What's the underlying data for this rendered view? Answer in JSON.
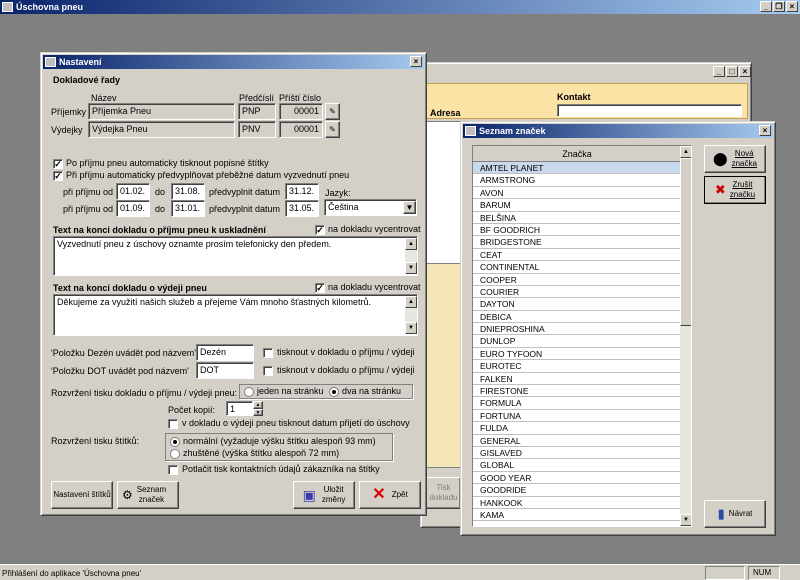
{
  "app": {
    "title": "Úschovna pneu",
    "status_text": "Přihlášení do aplikace 'Úschovna pneu'",
    "status_num": "NUM"
  },
  "background_window": {
    "col_adresa": "Adresa",
    "col_kontakt": "Kontakt"
  },
  "settings": {
    "title": "Nastavení",
    "section_doc_series": "Dokladové řady",
    "col_nazev": "Název",
    "col_predcisli": "Předčíslí",
    "col_pristi_cislo": "Příští číslo",
    "rows": [
      {
        "label": "Příjemky",
        "name": "Příjemka Pneu",
        "prefix": "PNP",
        "next": "00001"
      },
      {
        "label": "Výdejky",
        "name": "Výdejka Pneu",
        "prefix": "PNV",
        "next": "00001"
      }
    ],
    "chk_print_labels": "Po příjmu pneu automaticky tisknout popisné štítky",
    "chk_auto_fill": "Při příjmu automaticky předvyplňovat přeběžné datum vyzvednutí pneu",
    "ranges": [
      {
        "prefix": "při příjmu od",
        "from": "01.02.",
        "to_word": "do",
        "to": "31.08.",
        "fill_word": "předvyplnit datum",
        "date": "31.12."
      },
      {
        "prefix": "při příjmu od",
        "from": "01.09.",
        "to_word": "do",
        "to": "31.01.",
        "fill_word": "předvyplnit datum",
        "date": "31.05."
      }
    ],
    "language_label": "Jazyk:",
    "language_value": "Čeština",
    "receipt_text_label": "Text na konci dokladu o příjmu pneu k uskladnění",
    "receipt_center": "na dokladu vycentrovat",
    "receipt_text": "Vyzvednutí pneu z úschovy oznamte prosím telefonicky den předem.",
    "issue_text_label": "Text na konci dokladu o výdeji pneu",
    "issue_center": "na dokladu vycentrovat",
    "issue_text": "Děkujeme za využití našich služeb a přejeme Vám mnoho šťastných kilometrů.",
    "dezen_label": "'Položku Dezén uvádět pod názvem'",
    "dezen_value": "Dezén",
    "dezen_print": "tisknout v dokladu o příjmu / výdeji",
    "dot_label": "'Položku DOT uvádět pod názvem'",
    "dot_value": "DOT",
    "dot_print": "tisknout v dokladu o příjmu / výdeji",
    "layout_label": "Rozvržení tisku dokladu o příjmu / výdeji pneu:",
    "layout_one": "jeden na stránku",
    "layout_two": "dva na stránku",
    "copies_label": "Počet kopií:",
    "copies_value": "1",
    "chk_issue_date": "v dokladu o výdeji pneu tisknout datum přijetí do úschovy",
    "label_layout_label": "Rozvržení tisku štítků:",
    "label_normal": "normální  (vyžaduje výšku štítku alespoň 93 mm)",
    "label_dense": "zhuštěné  (výška štítku alespoň 72 mm)",
    "chk_suppress": "Potlačit tisk kontaktních údajů zákazníka na štítky",
    "btn_label_settings": "Nastavení štítků",
    "btn_brand_list": "Seznam\nznaček",
    "btn_save": "Uložit\nzměny",
    "btn_back": "Zpět",
    "btn_tisk": "Tisk\ndokladu"
  },
  "brands": {
    "title": "Seznam značek",
    "column": "Značka",
    "items": [
      "AMTEL PLANET",
      "ARMSTRONG",
      "AVON",
      "BARUM",
      "BELŠINA",
      "BF GOODRICH",
      "BRIDGESTONE",
      "CEAT",
      "CONTINENTAL",
      "COOPER",
      "COURIER",
      "DAYTON",
      "DEBICA",
      "DNIEPROSHINA",
      "DUNLOP",
      "EURO TYFOON",
      "EUROTEC",
      "FALKEN",
      "FIRESTONE",
      "FORMULA",
      "FORTUNA",
      "FULDA",
      "GENERAL",
      "GISLAVED",
      "GLOBAL",
      "GOOD YEAR",
      "GOODRIDE",
      "HANKOOK",
      "KAMA"
    ],
    "btn_new": "Nová\nznačka",
    "btn_delete": "Zrušit\nznačku",
    "btn_back": "Návrat"
  }
}
